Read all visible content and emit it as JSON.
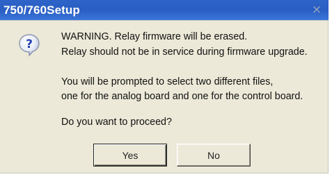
{
  "window": {
    "title": "750/760Setup",
    "close_glyph": "×"
  },
  "icon": {
    "name": "question-icon",
    "glyph": "?"
  },
  "message": {
    "line1": "WARNING. Relay firmware will be erased.",
    "line2": "Relay should not be in service during firmware upgrade.",
    "line3": "You will be prompted to select  two different files,",
    "line4": "one for the analog board and one for the control board.",
    "line5": "Do you want to proceed?"
  },
  "buttons": {
    "yes_label": "Yes",
    "no_label": "No"
  },
  "colors": {
    "titlebar": "#2a5ec3",
    "dialog_background": "#ece9d8",
    "icon_accent": "#2440b0"
  }
}
